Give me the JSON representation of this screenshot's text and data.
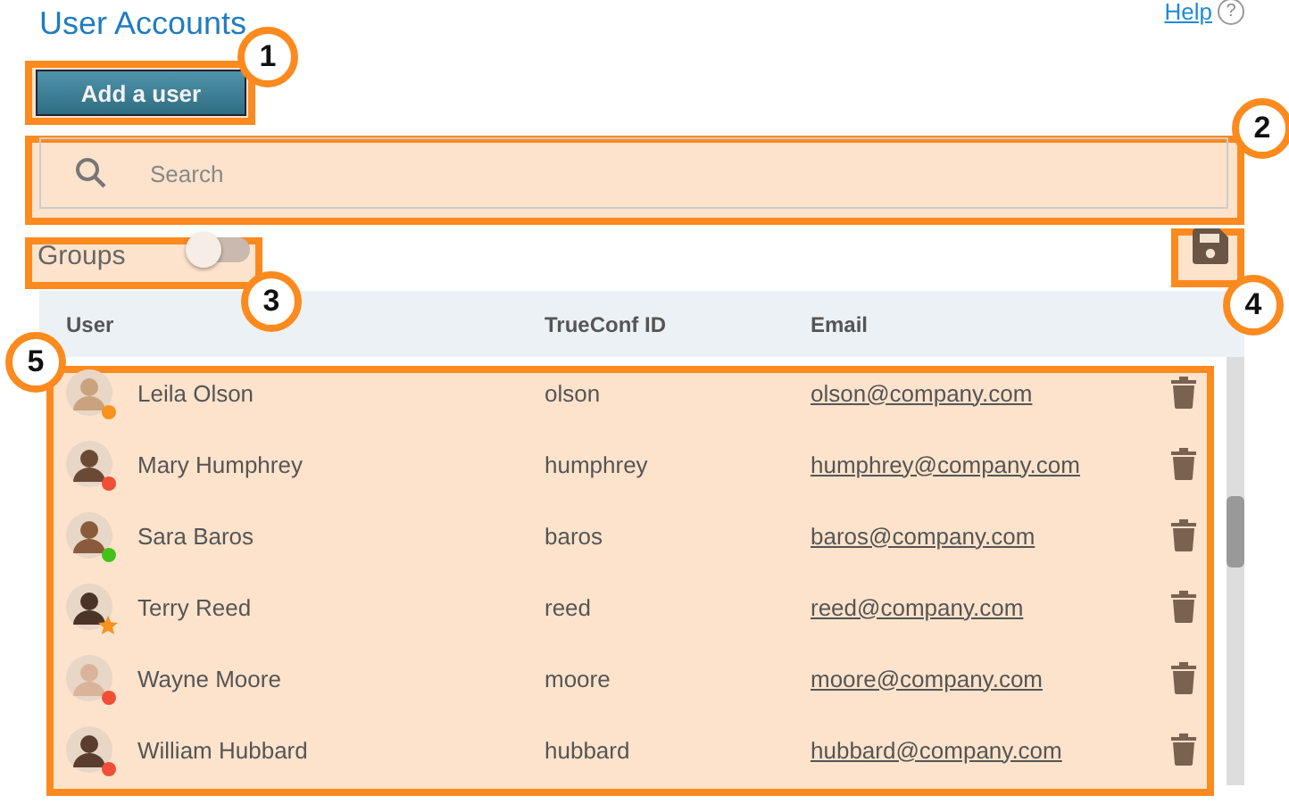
{
  "header": {
    "title": "User Accounts",
    "help_link": "Help",
    "help_icon": "?"
  },
  "add_button": "Add a user",
  "search": {
    "placeholder": "Search"
  },
  "groups_toggle": {
    "label": "Groups",
    "on": false
  },
  "table": {
    "columns": [
      "User",
      "TrueConf ID",
      "Email"
    ],
    "rows": [
      {
        "name": "Leila Olson",
        "id": "olson",
        "email": "olson@company.com",
        "status": {
          "kind": "dot",
          "color": "#f7931e"
        }
      },
      {
        "name": "Mary Humphrey",
        "id": "humphrey",
        "email": "humphrey@company.com",
        "status": {
          "kind": "dot",
          "color": "#f04e37"
        }
      },
      {
        "name": "Sara Baros",
        "id": "baros",
        "email": "baros@company.com",
        "status": {
          "kind": "dot",
          "color": "#44c21a"
        }
      },
      {
        "name": "Terry Reed",
        "id": "reed",
        "email": "reed@company.com",
        "status": {
          "kind": "star",
          "color": "#f7931e"
        }
      },
      {
        "name": "Wayne Moore",
        "id": "moore",
        "email": "moore@company.com",
        "status": {
          "kind": "dot",
          "color": "#f04e37"
        }
      },
      {
        "name": "William Hubbard",
        "id": "hubbard",
        "email": "hubbard@company.com",
        "status": {
          "kind": "dot",
          "color": "#f04e37"
        }
      }
    ]
  },
  "callouts": [
    {
      "number": "1"
    },
    {
      "number": "2"
    },
    {
      "number": "3"
    },
    {
      "number": "4"
    },
    {
      "number": "5"
    }
  ]
}
